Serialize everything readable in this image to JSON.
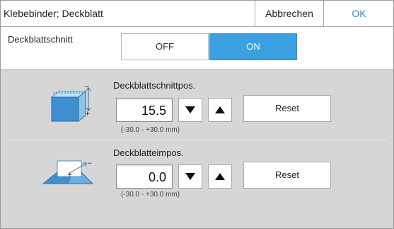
{
  "header": {
    "title": "Klebebinder; Deckblatt",
    "cancel_label": "Abbrechen",
    "ok_label": "OK"
  },
  "toggle": {
    "label": "Deckblattschnitt",
    "off_label": "OFF",
    "on_label": "ON",
    "selected": "ON"
  },
  "rows": [
    {
      "label": "Deckblattschnittpos.",
      "value": "15.5",
      "range": "(-30.0 - +30.0 mm)",
      "reset_label": "Reset"
    },
    {
      "label": "Deckblatteimpos.",
      "value": "0.0",
      "range": "(-30.0 - +30.0 mm)",
      "reset_label": "Reset"
    }
  ],
  "colors": {
    "accent": "#3aa0e0",
    "ok_text": "#2e88c8",
    "panel_bg": "#d6d6d6"
  }
}
